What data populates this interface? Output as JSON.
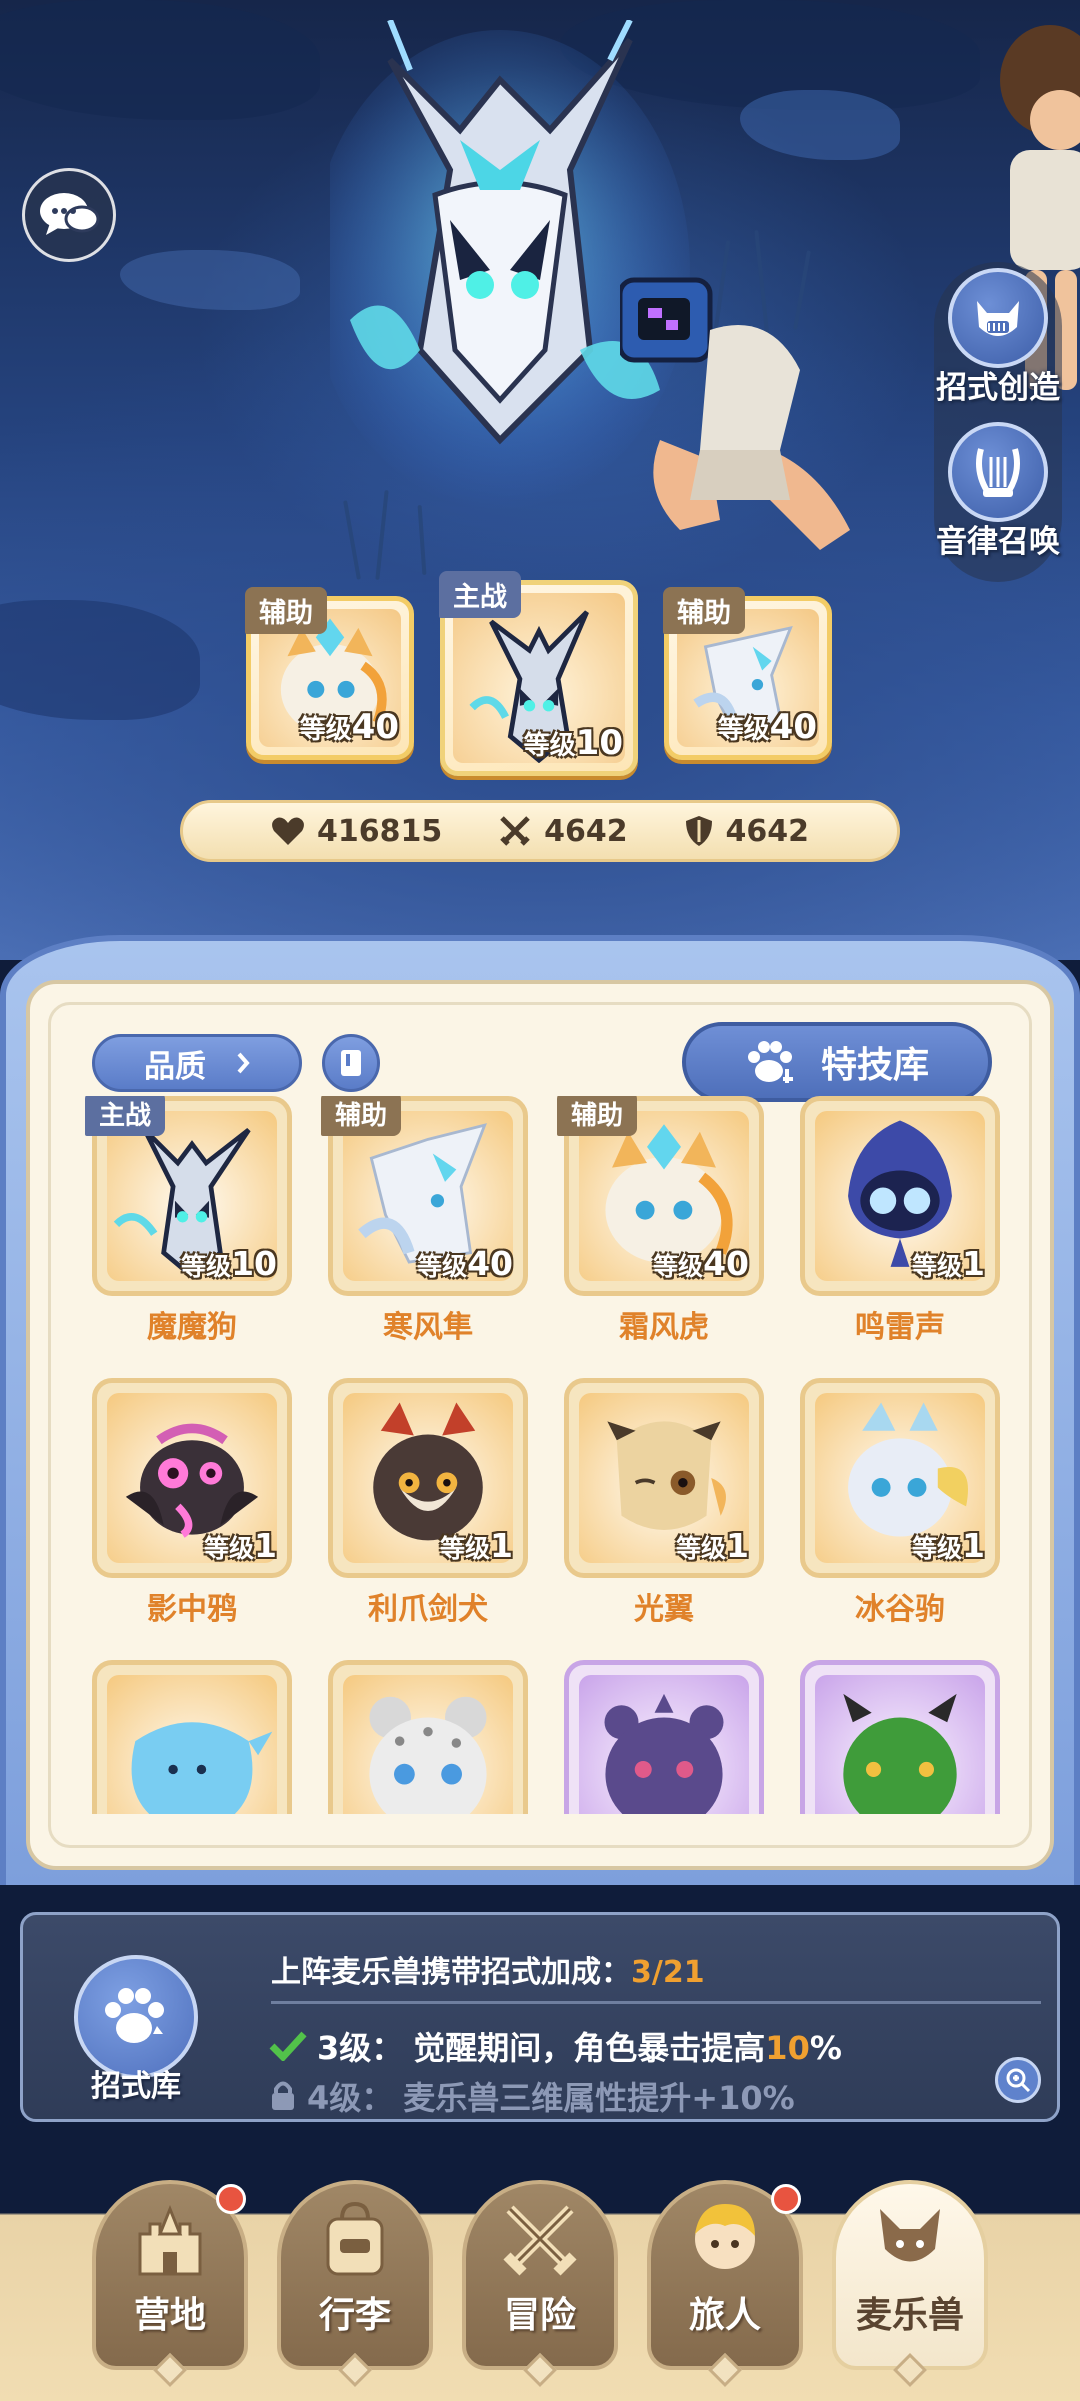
{
  "side_buttons": [
    {
      "label": "招式创造",
      "icon": "music-cat-icon"
    },
    {
      "label": "音律召唤",
      "icon": "lyre-icon"
    }
  ],
  "team": [
    {
      "role": "辅助",
      "level_label": "等级",
      "level": "40"
    },
    {
      "role": "主战",
      "level_label": "等级",
      "level": "10"
    },
    {
      "role": "辅助",
      "level_label": "等级",
      "level": "40"
    }
  ],
  "stats": {
    "hp": "416815",
    "attack": "4642",
    "defense": "4642"
  },
  "toolbar": {
    "quality_label": "品质",
    "skill_library_label": "特技库"
  },
  "monsters": [
    {
      "name": "魔魔狗",
      "tag": "主战",
      "level": "10",
      "color": "#b8c7e6"
    },
    {
      "name": "寒风隼",
      "tag": "辅助",
      "level": "40",
      "color": "#e8eef8"
    },
    {
      "name": "霜风虎",
      "tag": "辅助",
      "level": "40",
      "color": "#f2c27a"
    },
    {
      "name": "鸣雷声",
      "tag": "",
      "level": "1",
      "color": "#3d4aa8"
    },
    {
      "name": "影中鸦",
      "tag": "",
      "level": "1",
      "color": "#3a3038"
    },
    {
      "name": "利爪剑犬",
      "tag": "",
      "level": "1",
      "color": "#4a3a36"
    },
    {
      "name": "光翼",
      "tag": "",
      "level": "1",
      "color": "#ecd3a0"
    },
    {
      "name": "冰谷驹",
      "tag": "",
      "level": "1",
      "color": "#e8edf6"
    },
    {
      "name": "",
      "tag": "",
      "level": "",
      "color": "#79cdf2"
    },
    {
      "name": "",
      "tag": "",
      "level": "",
      "color": "#e2e2e2"
    },
    {
      "name": "",
      "tag": "",
      "level": "",
      "color": "#5a4a8c"
    },
    {
      "name": "",
      "tag": "",
      "level": "",
      "color": "#3f9c3a"
    }
  ],
  "level_label": "等级",
  "bonus": {
    "library_label": "招式库",
    "title": "上阵麦乐兽携带招式加成：",
    "count": "3/21",
    "line1_prefix": "3级：",
    "line1_text": "觉醒期间，角色暴击提高",
    "line1_value": "10",
    "line1_suffix": "%",
    "line2_prefix": "4级：",
    "line2_text": "麦乐兽三维属性提升+10%"
  },
  "nav": [
    {
      "label": "营地",
      "badge": true,
      "active": false
    },
    {
      "label": "行李",
      "badge": false,
      "active": false
    },
    {
      "label": "冒险",
      "badge": false,
      "active": false
    },
    {
      "label": "旅人",
      "badge": true,
      "active": false
    },
    {
      "label": "麦乐兽",
      "badge": false,
      "active": true
    }
  ]
}
